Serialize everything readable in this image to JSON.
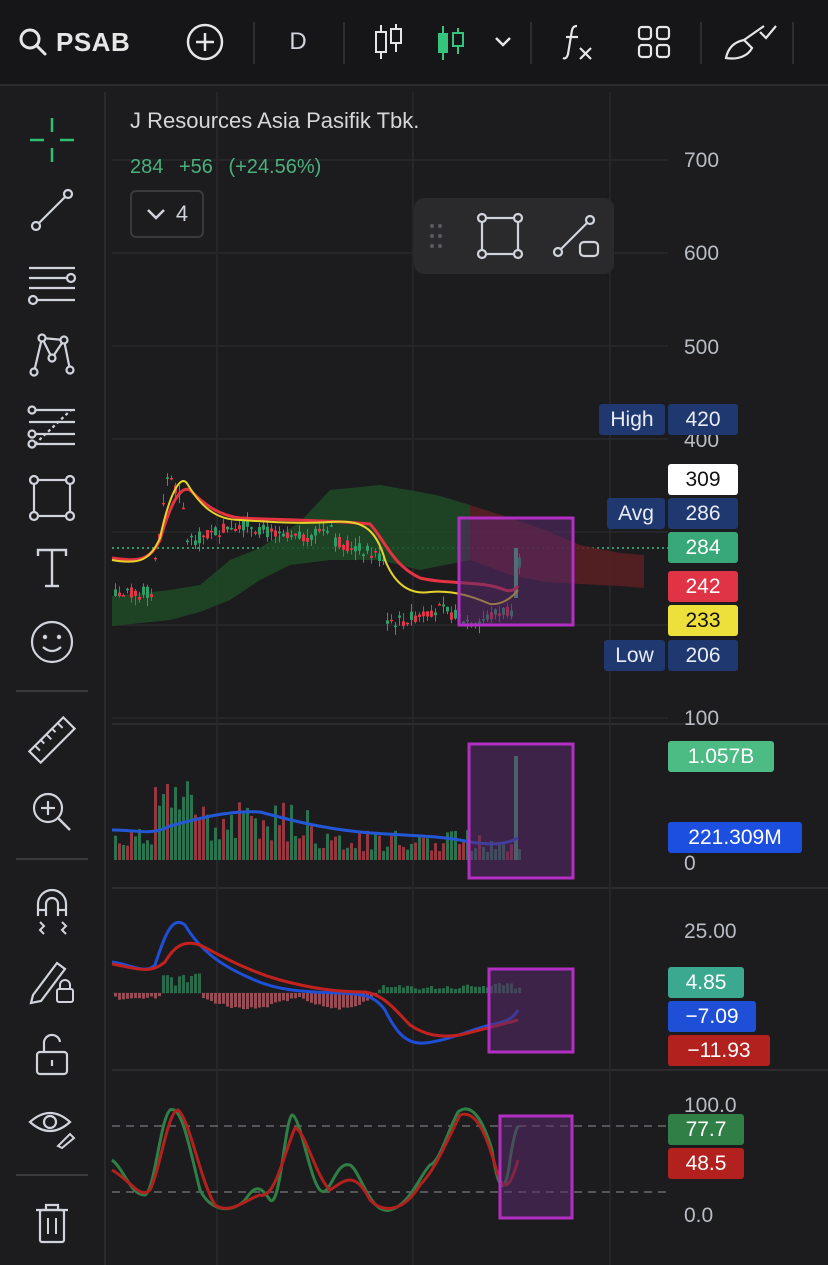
{
  "toolbar": {
    "symbol": "PSAB",
    "interval": "D",
    "icons": [
      "search-icon",
      "add-symbol-icon",
      "candlestick-icon",
      "candlestick-green-icon",
      "chevron-down-icon",
      "indicators-icon",
      "layout-grid-icon",
      "brush-icon"
    ]
  },
  "legend": {
    "title": "J Resources Asia Pasifik Tbk.",
    "last": "284",
    "change": "+56",
    "change_pct": "(+24.56%)",
    "collapsed_count": "4"
  },
  "sidebar": {
    "tools": [
      "crosshair-icon",
      "trendline-icon",
      "parallel-lines-icon",
      "pattern-icon",
      "fib-icon",
      "rectangle-icon",
      "text-icon",
      "emoji-icon",
      "ruler-icon",
      "zoom-icon",
      "magnet-icon",
      "lock-drawing-icon",
      "unlock-icon",
      "eye-icon",
      "trash-icon"
    ]
  },
  "price_axis": {
    "ticks": [
      "700",
      "600",
      "500",
      "400",
      "100"
    ],
    "tags": {
      "high_label": "High",
      "high_value": "420",
      "last_white": "309",
      "avg_label": "Avg",
      "avg_value": "286",
      "current": "284",
      "red_ma": "242",
      "yellow_ma": "233",
      "low_label": "Low",
      "low_value": "206"
    }
  },
  "volume_pane": {
    "tick_zero": "0",
    "volume_tag": "1.057B",
    "ma_tag": "221.309M"
  },
  "macd_pane": {
    "tick_top": "25.00",
    "hist_tag": "4.85",
    "macd_tag": "−7.09",
    "signal_tag": "−11.93"
  },
  "stoch_pane": {
    "tick_top": "100.0",
    "tick_bottom": "0.0",
    "k_tag": "77.7",
    "d_tag": "48.5"
  },
  "colors": {
    "up": "#2e9e68",
    "down": "#e0384b",
    "ma_red": "#e53341",
    "ma_yellow": "#e6d32a",
    "volume_ma": "#2457d6",
    "selection": "#b32fc4",
    "tag_blue": "#1f3870"
  }
}
